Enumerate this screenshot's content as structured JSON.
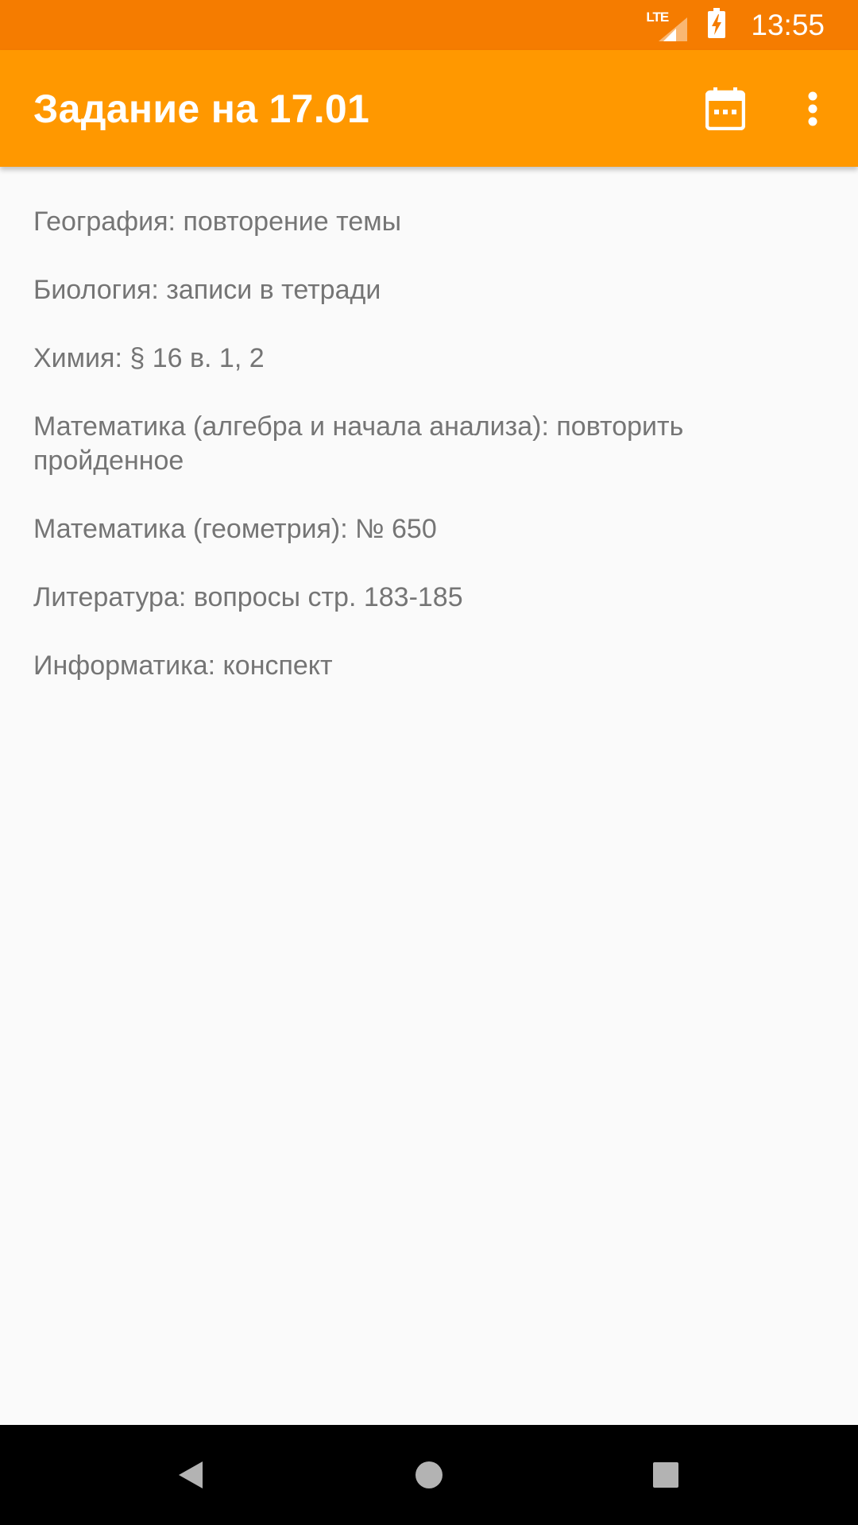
{
  "status_bar": {
    "network": "LTE",
    "time": "13:55",
    "icons": [
      "lte-signal-icon",
      "battery-charging-icon"
    ]
  },
  "app_bar": {
    "title": "Задание на 17.01",
    "actions": [
      "calendar-icon",
      "more-vert-icon"
    ],
    "color": "#ff9800",
    "status_color": "#f57c00"
  },
  "tasks": [
    "География: повторение темы",
    "Биология: записи в тетради",
    "Химия: § 16 в. 1, 2",
    "Математика (алгебра и начала анализа): повторить пройденное",
    "Математика (геометрия): № 650",
    "Литература: вопросы стр. 183-185",
    "Информатика: конспект"
  ],
  "nav_bar": {
    "buttons": [
      "back-icon",
      "home-icon",
      "recents-icon"
    ]
  }
}
